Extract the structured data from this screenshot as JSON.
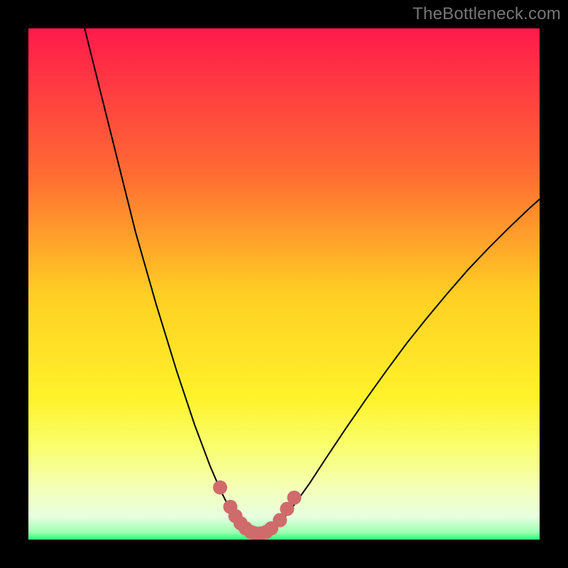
{
  "watermark": "TheBottleneck.com",
  "colors": {
    "frame": "#000000",
    "curve": "#000000",
    "markers": "#cf6b6b",
    "gradient_top": "#ff1a4b",
    "gradient_mid_upper": "#ff8a2a",
    "gradient_mid": "#ffe327",
    "gradient_lowband_top": "#f8ff7a",
    "gradient_lowband_mid": "#f2ffd4",
    "gradient_bottom": "#2bff77"
  },
  "chart_data": {
    "type": "line",
    "title": "",
    "xlabel": "",
    "ylabel": "",
    "xlim": [
      0,
      100
    ],
    "ylim": [
      0,
      100
    ],
    "series": [
      {
        "name": "curve",
        "x": [
          11,
          13,
          15,
          17,
          19,
          21,
          23,
          25,
          27,
          29,
          31,
          32.5,
          34,
          35.5,
          37,
          38,
          39,
          40,
          41,
          42,
          43,
          44,
          45,
          46,
          47,
          48,
          50,
          52,
          55,
          58,
          62,
          66,
          70,
          74,
          78,
          82,
          86,
          90,
          94,
          98,
          100
        ],
        "y": [
          100,
          92,
          84,
          76,
          68,
          60,
          53,
          46,
          39.5,
          33,
          27,
          22.5,
          18.5,
          14.5,
          11,
          8.8,
          6.8,
          5.2,
          3.8,
          2.6,
          1.8,
          1.2,
          1.1,
          1.2,
          1.6,
          2.3,
          4.2,
          6.8,
          11,
          15.6,
          21.6,
          27.4,
          33,
          38.4,
          43.4,
          48.2,
          52.8,
          57,
          61,
          64.8,
          66.6
        ]
      }
    ],
    "markers": {
      "name": "bottom-markers",
      "x": [
        37.5,
        39.5,
        40.5,
        41.5,
        42.5,
        43.5,
        44.5,
        45.5,
        46.5,
        47.5,
        49.2,
        50.6,
        52.0
      ],
      "y": [
        10.2,
        6.4,
        4.6,
        3.2,
        2.2,
        1.5,
        1.2,
        1.2,
        1.5,
        2.2,
        3.8,
        6.0,
        8.2
      ]
    },
    "gradient_stops": [
      {
        "offset": 0.0,
        "color": "#ff1a4b"
      },
      {
        "offset": 0.28,
        "color": "#ff6a33"
      },
      {
        "offset": 0.52,
        "color": "#ffcf23"
      },
      {
        "offset": 0.72,
        "color": "#fff22a"
      },
      {
        "offset": 0.82,
        "color": "#f9ff6f"
      },
      {
        "offset": 0.9,
        "color": "#f4ffb8"
      },
      {
        "offset": 0.955,
        "color": "#e8ffe0"
      },
      {
        "offset": 0.985,
        "color": "#9fffb3"
      },
      {
        "offset": 1.0,
        "color": "#2bff77"
      }
    ]
  }
}
